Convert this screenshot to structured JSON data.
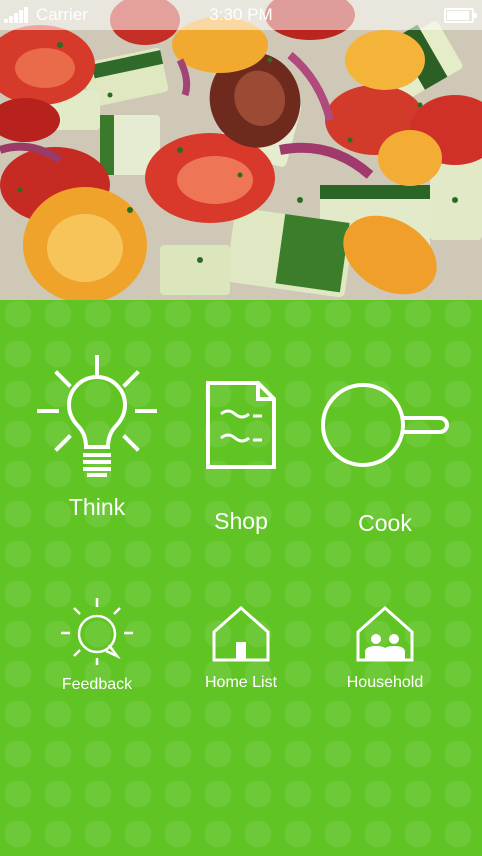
{
  "status_bar": {
    "carrier": "Carrier",
    "time": "3:30 PM",
    "signal_bars": 5,
    "battery_level": 1.0
  },
  "hero": {
    "icon": "salad-photo"
  },
  "menu": {
    "primary": [
      {
        "label": "Think",
        "icon": "lightbulb-icon"
      },
      {
        "label": "Shop",
        "icon": "shopping-list-icon"
      },
      {
        "label": "Cook",
        "icon": "frying-pan-icon"
      }
    ],
    "secondary": [
      {
        "label": "Feedback",
        "icon": "feedback-bubble-icon"
      },
      {
        "label": "Home List",
        "icon": "house-icon"
      },
      {
        "label": "Household",
        "icon": "household-people-icon"
      }
    ]
  },
  "colors": {
    "background": "#5fc424",
    "pattern": "#6ccb33",
    "text": "#ffffff"
  }
}
